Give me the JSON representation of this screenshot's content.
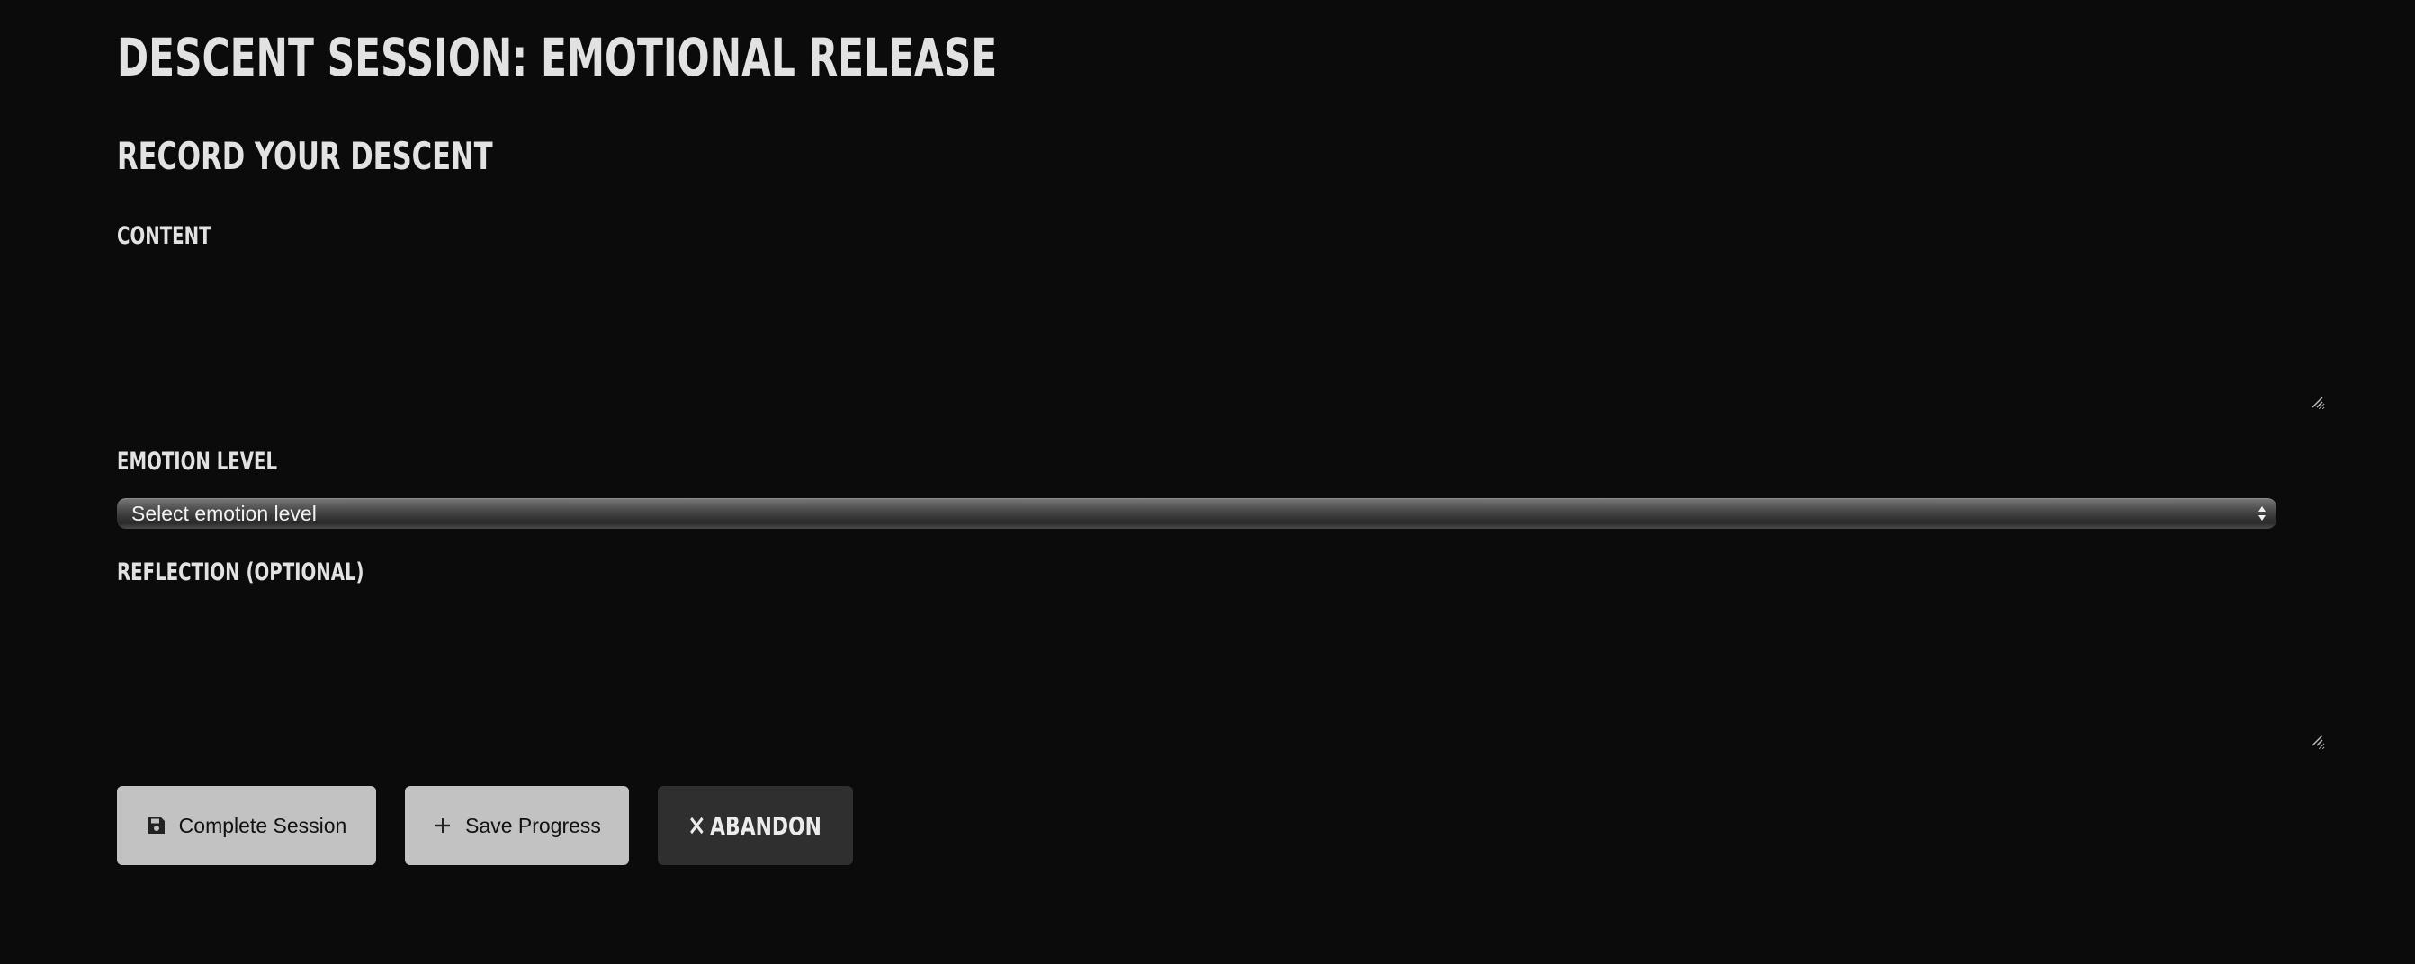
{
  "header": {
    "title": "DESCENT SESSION: EMOTIONAL RELEASE"
  },
  "form": {
    "section_title": "RECORD YOUR DESCENT",
    "content_label": "CONTENT",
    "content_value": "",
    "emotion_label": "EMOTION LEVEL",
    "emotion_selected": "Select emotion level",
    "reflection_label": "REFLECTION (OPTIONAL)",
    "reflection_value": ""
  },
  "actions": {
    "complete_label": "Complete Session",
    "complete_icon": "floppy-disk-icon",
    "save_label": "Save Progress",
    "save_icon": "plus-icon",
    "abandon_label": "ABANDON",
    "abandon_icon": "close-icon"
  },
  "colors": {
    "background": "#0b0b0b",
    "text": "#e2e2e2",
    "button_light": "#c2c2c2",
    "button_dark": "#2f2f2f"
  }
}
